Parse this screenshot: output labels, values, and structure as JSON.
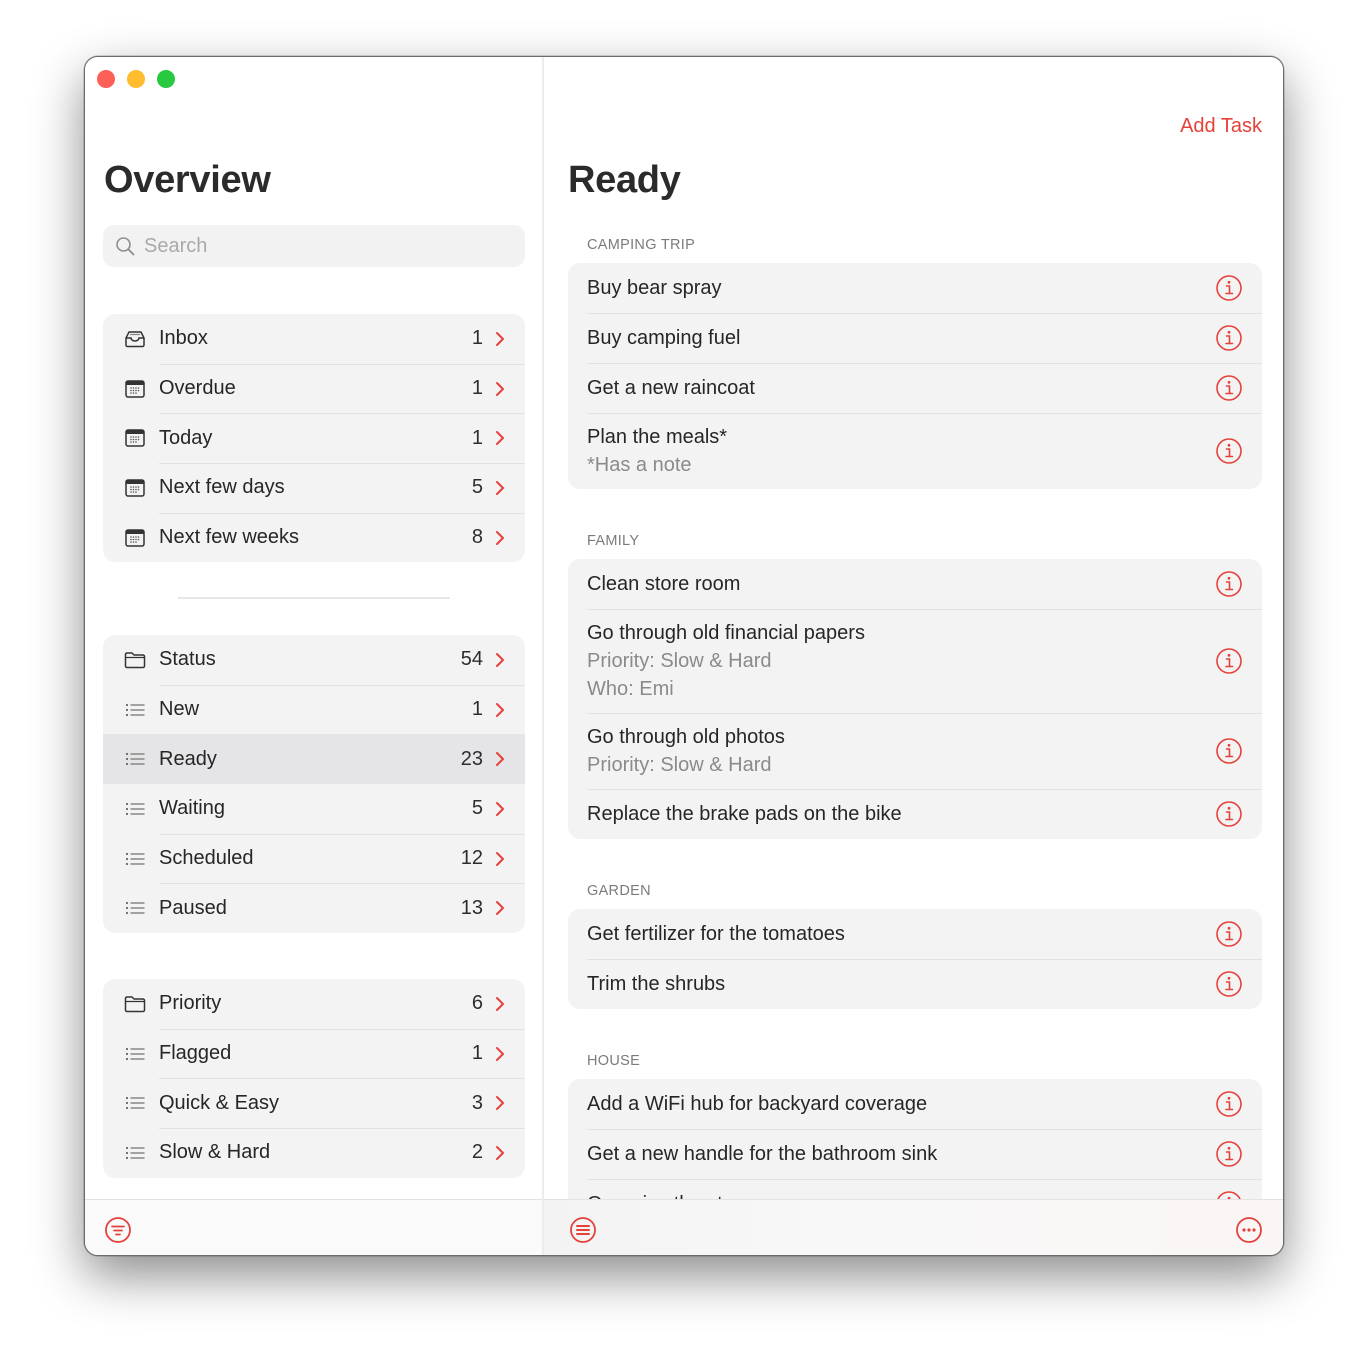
{
  "window": {
    "controls": [
      "close",
      "minimize",
      "maximize"
    ]
  },
  "sidebar": {
    "title": "Overview",
    "search": {
      "placeholder": "Search",
      "value": ""
    },
    "groups": [
      {
        "items": [
          {
            "label": "Inbox",
            "count": "1",
            "icon": "tray-icon"
          },
          {
            "label": "Overdue",
            "count": "1",
            "icon": "calendar-icon"
          },
          {
            "label": "Today",
            "count": "1",
            "icon": "calendar-icon"
          },
          {
            "label": "Next few days",
            "count": "5",
            "icon": "calendar-icon"
          },
          {
            "label": "Next few weeks",
            "count": "8",
            "icon": "calendar-icon"
          }
        ]
      },
      {
        "items": [
          {
            "label": "Status",
            "count": "54",
            "icon": "folder-icon"
          },
          {
            "label": "New",
            "count": "1",
            "icon": "list-icon"
          },
          {
            "label": "Ready",
            "count": "23",
            "icon": "list-icon",
            "selected": true
          },
          {
            "label": "Waiting",
            "count": "5",
            "icon": "list-icon"
          },
          {
            "label": "Scheduled",
            "count": "12",
            "icon": "list-icon"
          },
          {
            "label": "Paused",
            "count": "13",
            "icon": "list-icon"
          }
        ]
      },
      {
        "items": [
          {
            "label": "Priority",
            "count": "6",
            "icon": "folder-icon"
          },
          {
            "label": "Flagged",
            "count": "1",
            "icon": "list-icon"
          },
          {
            "label": "Quick & Easy",
            "count": "3",
            "icon": "list-icon"
          },
          {
            "label": "Slow & Hard",
            "count": "2",
            "icon": "list-icon"
          }
        ]
      }
    ]
  },
  "main": {
    "add_task_label": "Add Task",
    "title": "Ready",
    "sections": [
      {
        "header": "CAMPING TRIP",
        "tasks": [
          {
            "title": "Buy bear spray",
            "subtitles": []
          },
          {
            "title": "Buy camping fuel",
            "subtitles": []
          },
          {
            "title": "Get a new raincoat",
            "subtitles": []
          },
          {
            "title": "Plan the meals*",
            "subtitles": [
              "*Has a note"
            ]
          }
        ]
      },
      {
        "header": "FAMILY",
        "tasks": [
          {
            "title": "Clean store room",
            "subtitles": []
          },
          {
            "title": "Go through old financial papers",
            "subtitles": [
              "Priority: Slow & Hard",
              "Who: Emi"
            ]
          },
          {
            "title": "Go through old photos",
            "subtitles": [
              "Priority: Slow & Hard"
            ]
          },
          {
            "title": "Replace the brake pads on the bike",
            "subtitles": []
          }
        ]
      },
      {
        "header": "GARDEN",
        "tasks": [
          {
            "title": "Get fertilizer for the tomatoes",
            "subtitles": []
          },
          {
            "title": "Trim the shrubs",
            "subtitles": []
          }
        ]
      },
      {
        "header": "HOUSE",
        "tasks": [
          {
            "title": "Add a WiFi hub for backyard coverage",
            "subtitles": []
          },
          {
            "title": "Get a new handle for the bathroom sink",
            "subtitles": []
          },
          {
            "title": "Organize the storage room",
            "subtitles": []
          }
        ]
      }
    ]
  },
  "toolbar": {
    "left_button": "filter-icon",
    "middle_button": "list-menu-icon",
    "right_button": "more-icon"
  },
  "colors": {
    "accent": "#e5413a",
    "group_bg": "#f4f3f4",
    "selected_bg": "#e5e4e6",
    "secondary_text": "#8a898c"
  }
}
